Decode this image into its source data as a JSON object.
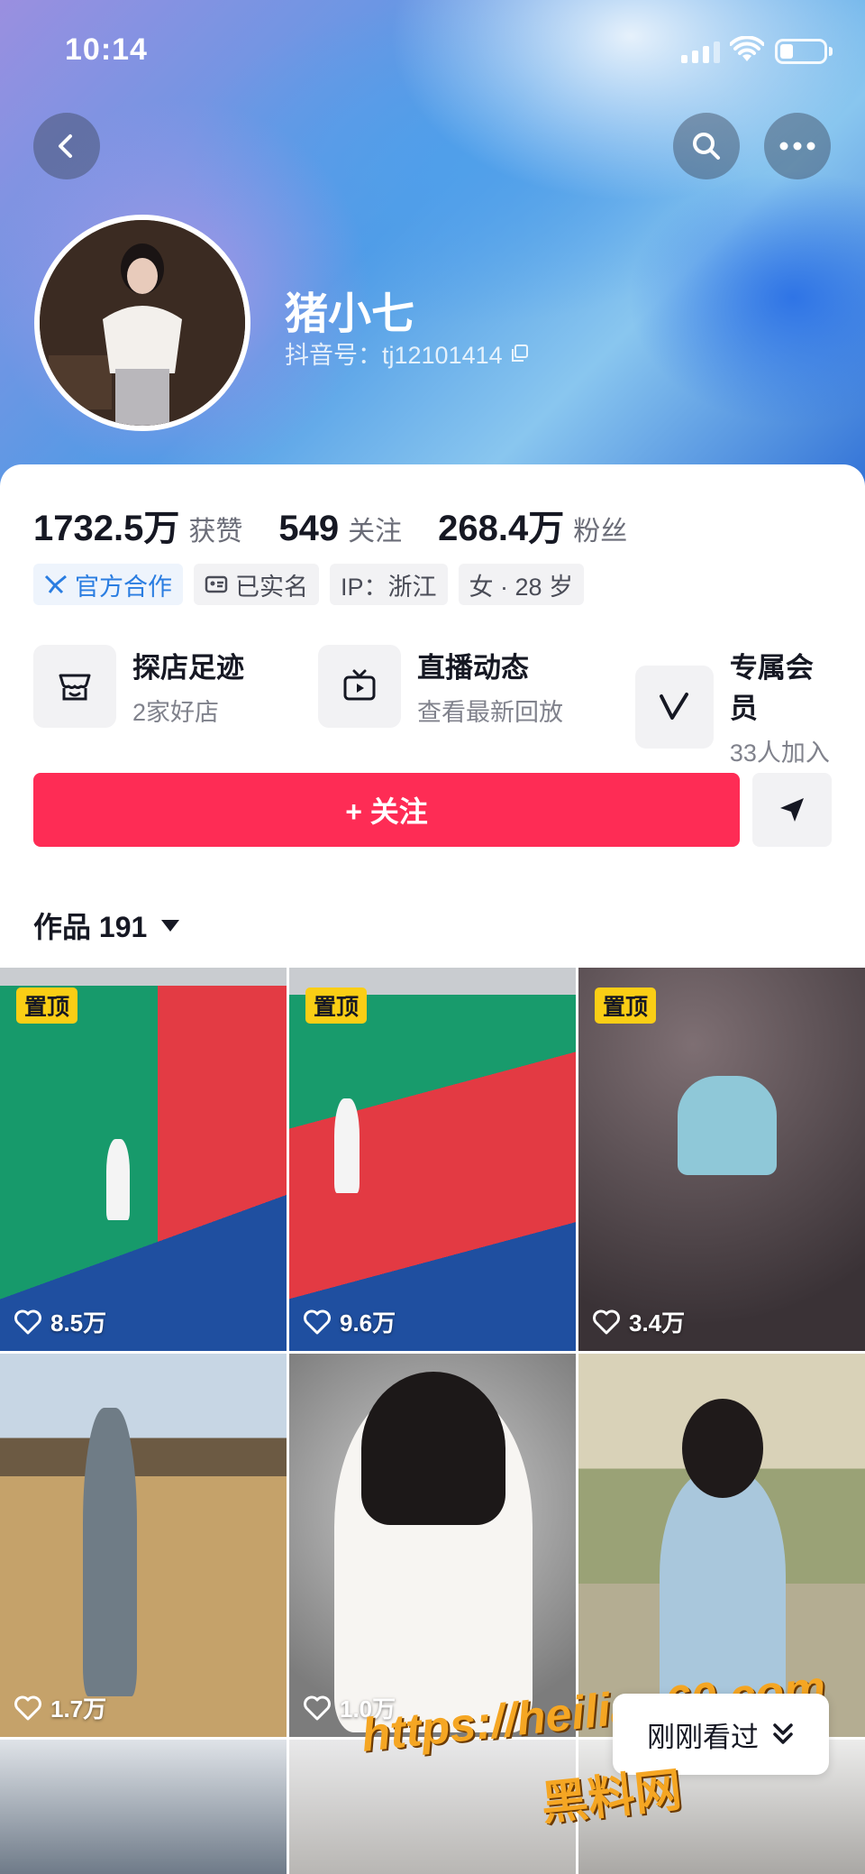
{
  "status_bar": {
    "time": "10:14"
  },
  "profile": {
    "nickname": "猪小七",
    "douyin_id": "抖音号：tj12101414"
  },
  "stats": [
    {
      "num": "1732.5万",
      "label": "获赞"
    },
    {
      "num": "549",
      "label": "关注"
    },
    {
      "num": "268.4万",
      "label": "粉丝"
    }
  ],
  "tags": [
    {
      "label": "官方合作",
      "icon": "official-icon"
    },
    {
      "label": "已实名",
      "icon": "id-card-icon"
    },
    {
      "label": "IP：浙江"
    },
    {
      "label": "女 · 28 岁"
    }
  ],
  "features": [
    {
      "title": "探店足迹",
      "sub": "2家好店",
      "icon": "store-icon"
    },
    {
      "title": "直播动态",
      "sub": "查看最新回放",
      "icon": "tv-icon"
    },
    {
      "title": "专属会员",
      "sub": "33人加入",
      "icon": "v-icon"
    }
  ],
  "actions": {
    "follow": "+ 关注"
  },
  "works": {
    "label": "作品 191"
  },
  "grid": [
    {
      "pinned": "置顶",
      "likes": "8.5万"
    },
    {
      "pinned": "置顶",
      "likes": "9.6万"
    },
    {
      "pinned": "置顶",
      "likes": "3.4万"
    },
    {
      "pinned": "",
      "likes": "1.7万"
    },
    {
      "pinned": "",
      "likes": "1.0万"
    },
    {
      "pinned": "",
      "likes": ""
    }
  ],
  "recent": {
    "label": "刚刚看过"
  },
  "watermark": {
    "line1": "https://heiliao60.com",
    "line2": "黑料网"
  },
  "colors": {
    "accent": "#fe2c55",
    "pin": "#face15",
    "official": "#2a7de1"
  }
}
